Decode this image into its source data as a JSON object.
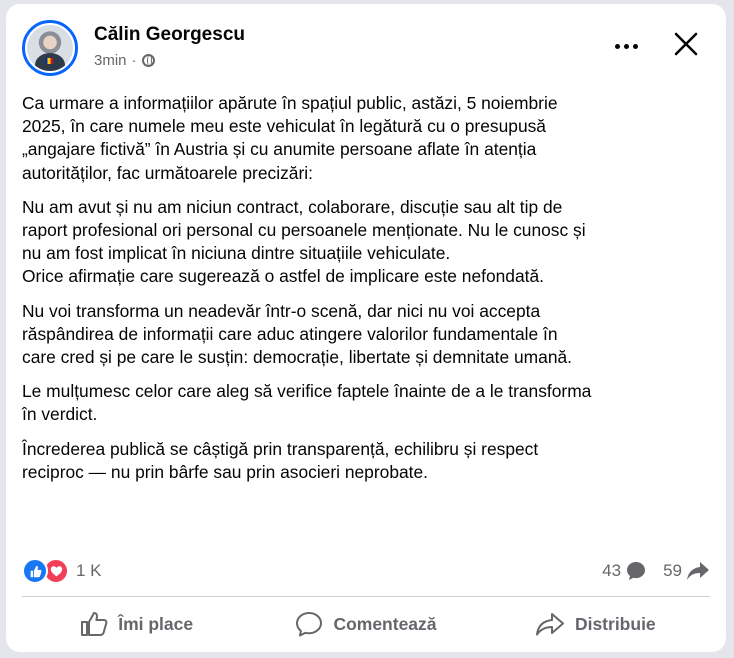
{
  "post": {
    "author": "Călin Georgescu",
    "time": "3min",
    "paragraphs": [
      "Ca urmare a informațiilor apărute în spațiul public, astăzi, 5 noiembrie\n2025, în care numele meu este vehiculat în legătură cu o presupusă\n„angajare fictivă” în Austria și cu anumite persoane aflate în atenția\nautorităților, fac următoarele precizări:",
      "Nu am avut și nu am niciun contract, colaborare, discuție sau alt tip de\nraport profesional ori personal cu persoanele menționate. Nu le cunosc și\nnu am fost implicat în niciuna dintre situațiile vehiculate.\nOrice afirmație care sugerează o astfel de implicare este nefondată.",
      "Nu voi transforma un neadevăr într-o scenă, dar nici nu voi accepta\nrăspândirea de informații care aduc atingere valorilor fundamentale în\ncare cred și pe care le susțin: democrație, libertate și demnitate umană.",
      "Le mulțumesc celor care aleg să verifice faptele înainte de a le transforma\nîn verdict.",
      "Încrederea publică se câștigă prin transparență, echilibru și respect\nreciproc — nu prin bârfe sau prin asocieri neprobate."
    ]
  },
  "stats": {
    "reactions_count": "1 K",
    "comments_count": "43",
    "shares_count": "59"
  },
  "actions": {
    "like_label": "Îmi place",
    "comment_label": "Comentează",
    "share_label": "Distribuie"
  },
  "icons": {
    "like": "thumbs-up-icon",
    "love": "heart-icon",
    "comment": "speech-bubble-icon",
    "share": "share-arrow-icon",
    "privacy": "globe-icon",
    "more": "more-icon",
    "close": "close-icon"
  },
  "colors": {
    "accent": "#0866ff",
    "like": "#1877f2",
    "love": "#f33e58",
    "secondary_text": "#65676b"
  }
}
